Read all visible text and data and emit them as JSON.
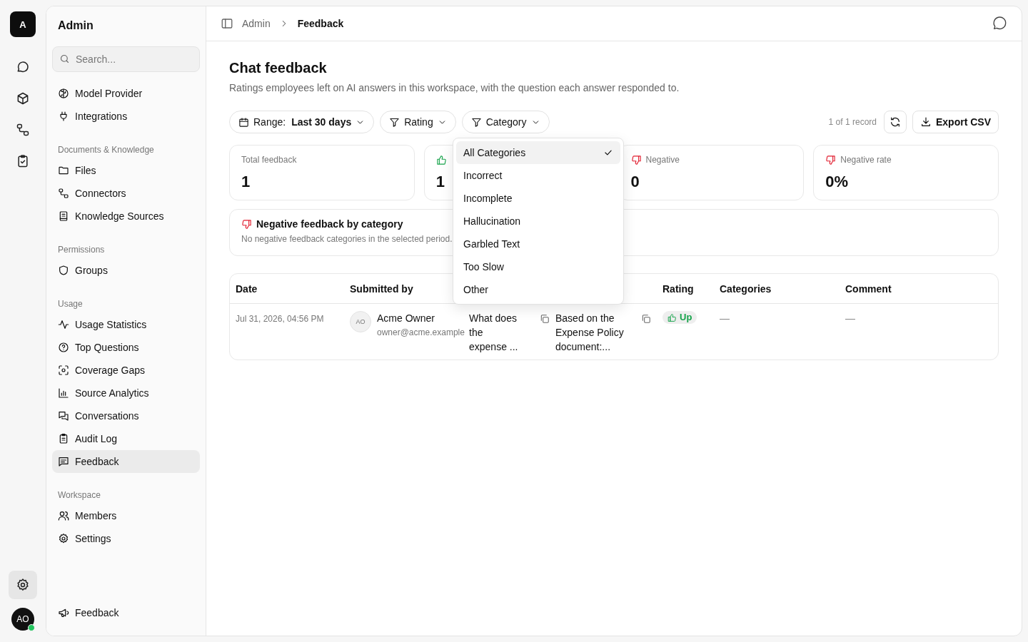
{
  "rail": {
    "logo": "A",
    "items": [
      {
        "selected": false
      },
      {
        "selected": false
      },
      {
        "selected": false
      },
      {
        "selected": false
      }
    ],
    "settings": {
      "selected": true
    },
    "avatar": {
      "initials": "AO",
      "online": true
    }
  },
  "sidebar": {
    "title": "Admin",
    "search": {
      "placeholder": "Search..."
    },
    "sections": [
      {
        "items": [
          {
            "label": "Model Provider",
            "selected": false
          },
          {
            "label": "Integrations",
            "selected": false
          }
        ]
      },
      {
        "label": "Documents & Knowledge",
        "items": [
          {
            "label": "Files",
            "selected": false
          },
          {
            "label": "Connectors",
            "selected": false
          },
          {
            "label": "Knowledge Sources",
            "selected": false
          }
        ]
      },
      {
        "label": "Permissions",
        "items": [
          {
            "label": "Groups",
            "selected": false
          }
        ]
      },
      {
        "label": "Usage",
        "items": [
          {
            "label": "Usage Statistics",
            "selected": false
          },
          {
            "label": "Top Questions",
            "selected": false
          },
          {
            "label": "Coverage Gaps",
            "selected": false
          },
          {
            "label": "Source Analytics",
            "selected": false
          },
          {
            "label": "Conversations",
            "selected": false
          },
          {
            "label": "Audit Log",
            "selected": false
          },
          {
            "label": "Feedback",
            "selected": true
          }
        ]
      },
      {
        "label": "Workspace",
        "items": [
          {
            "label": "Members",
            "selected": false
          },
          {
            "label": "Settings",
            "selected": false
          }
        ]
      }
    ],
    "footer_item": "Feedback"
  },
  "breadcrumb": [
    "Admin",
    "Feedback"
  ],
  "page": {
    "title": "Chat feedback",
    "subtitle": "Ratings employees left on AI answers in this workspace, with the question each answer responded to.",
    "filters": [
      {
        "kind": "range",
        "label": "Range:",
        "value": "Last 30 days"
      },
      {
        "kind": "filter",
        "label": "Rating"
      },
      {
        "kind": "filter",
        "label": "Category",
        "options": [
          {
            "label": "All Categories",
            "selected": true
          },
          {
            "label": "Incorrect",
            "selected": false
          },
          {
            "label": "Incomplete",
            "selected": false
          },
          {
            "label": "Hallucination",
            "selected": false
          },
          {
            "label": "Garbled Text",
            "selected": false
          },
          {
            "label": "Too Slow",
            "selected": false
          },
          {
            "label": "Other",
            "selected": false
          }
        ]
      }
    ],
    "record_count": "1 of 1 record",
    "export_label": "Export CSV",
    "stats": [
      {
        "kind": "plain",
        "label": "Total feedback",
        "value": "1"
      },
      {
        "kind": "positive",
        "value": "1"
      },
      {
        "kind": "negative",
        "label": "Negative",
        "value": "0"
      },
      {
        "kind": "negative",
        "label": "Negative rate",
        "value": "0%"
      }
    ],
    "category_panel": {
      "title": "Negative feedback by category",
      "empty_text": "No negative feedback categories in the selected period."
    },
    "table": {
      "columns": [
        "Date",
        "Submitted by",
        "Rating",
        "Categories",
        "Comment"
      ],
      "rows": [
        {
          "date": "Jul 31, 2026, 04:56 PM",
          "submitter": {
            "initials": "AO",
            "name": "Acme Owner",
            "email": "owner@acme.example"
          },
          "question": "What does the expense ...",
          "answer": "Based on the Expense Policy document:...",
          "rating": {
            "kind": "up",
            "label": "Up"
          },
          "categories": "—",
          "comment": "—"
        }
      ]
    }
  }
}
